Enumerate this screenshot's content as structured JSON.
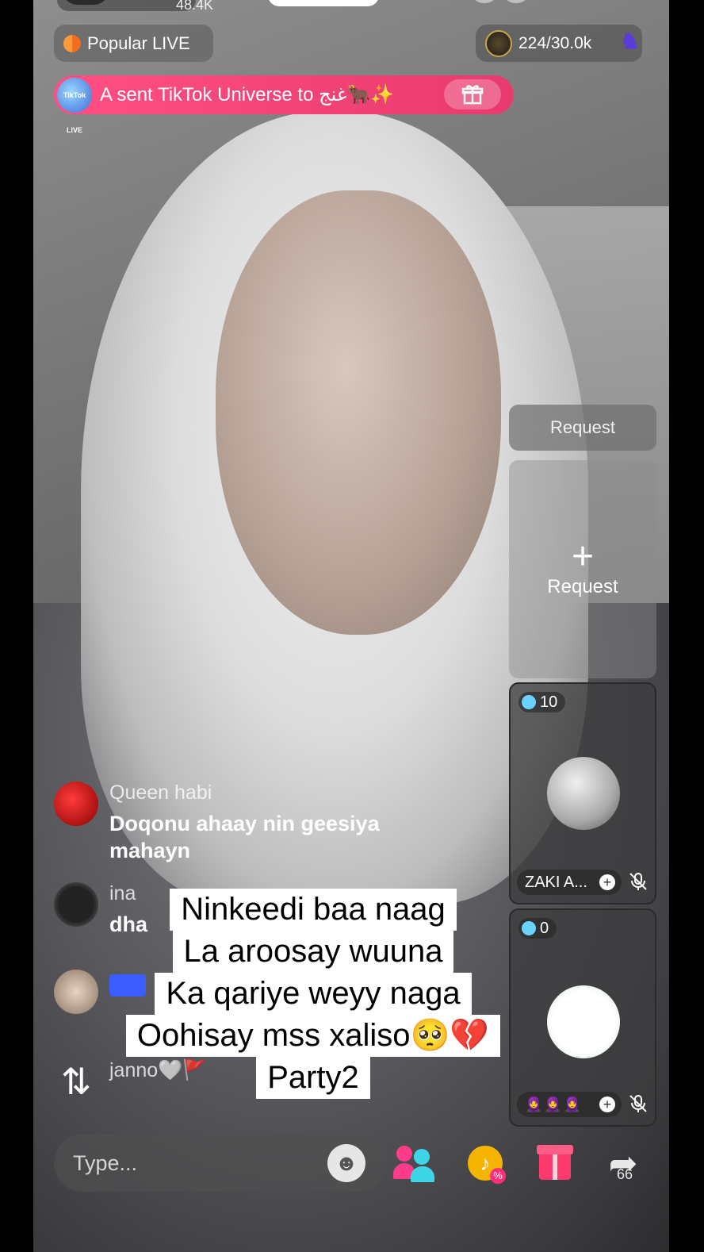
{
  "top": {
    "likes": "48.4K",
    "popular_label": "Popular LIVE",
    "viewers": "224/30.0k"
  },
  "gift_banner": {
    "logo_text": "TikTok LIVE",
    "text": "A sent TikTok Universe to غنج🐂✨"
  },
  "side_panel": {
    "request_button": "Request",
    "request_slot_plus": "+",
    "request_slot_label": "Request",
    "guest_1": {
      "score": "10",
      "name": "ZAKI A..."
    },
    "guest_2": {
      "score": "0",
      "emojis": "🧕🧕🧕"
    }
  },
  "comments": [
    {
      "user": "Queen habi",
      "text_line1": "Doqonu ahaay nin geesiya",
      "text_line2": "mahayn"
    },
    {
      "user": "ina",
      "text": "dha"
    },
    {
      "user": "",
      "text": ""
    },
    {
      "user": "janno🤍🚩"
    }
  ],
  "caption": {
    "line1": "Ninkeedi baa naag",
    "line2": "La aroosay wuuna",
    "line3": "Ka qariye weyy naga",
    "line4": "Oohisay mss xaliso🥺💔",
    "line5": "Party2"
  },
  "bottom_bar": {
    "input_placeholder": "Type...",
    "share_count": "66"
  },
  "icons": {
    "emoji": "emoji-icon",
    "multi_guest": "multi-guest-icon",
    "promote": "promote-icon",
    "gift": "gift-icon",
    "share": "share-icon",
    "repost": "repost-icon",
    "mute": "mic-off-icon"
  },
  "colors": {
    "banner_pink": "#ff4f83",
    "guest_pink": "#ff3b8a",
    "guest_cyan": "#3ed6e6",
    "promote_gold": "#f5b400"
  }
}
